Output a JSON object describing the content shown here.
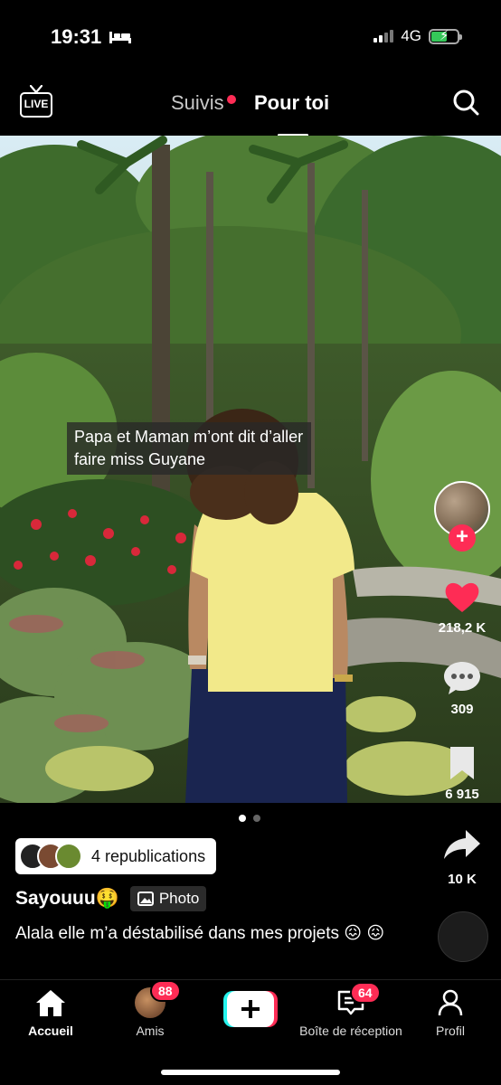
{
  "status_bar": {
    "time": "19:31",
    "network": "4G"
  },
  "top_nav": {
    "live_label": "LIVE",
    "tab_following": "Suivis",
    "tab_for_you": "Pour toi"
  },
  "post": {
    "caption_overlay": "Papa et Maman m’ont dit d’aller faire miss Guyane",
    "likes": "218,2 K",
    "comments": "309",
    "saves": "6 915",
    "shares": "10 K",
    "republications": "4 republications",
    "username": "Sayouuu",
    "username_emoji": "🤑",
    "type_tag": "Photo",
    "description": "Alala elle m’a déstabilisé dans mes projets 😖 😖",
    "slide_count": 2,
    "active_slide": 1
  },
  "tab_bar": {
    "home": "Accueil",
    "friends": "Amis",
    "friends_badge": "88",
    "inbox": "Boîte de réception",
    "inbox_badge": "64",
    "profile": "Profil"
  },
  "colors": {
    "accent": "#fe2c55",
    "background": "#000000",
    "shirt": "#f2e98a",
    "shorts": "#1a2550"
  }
}
